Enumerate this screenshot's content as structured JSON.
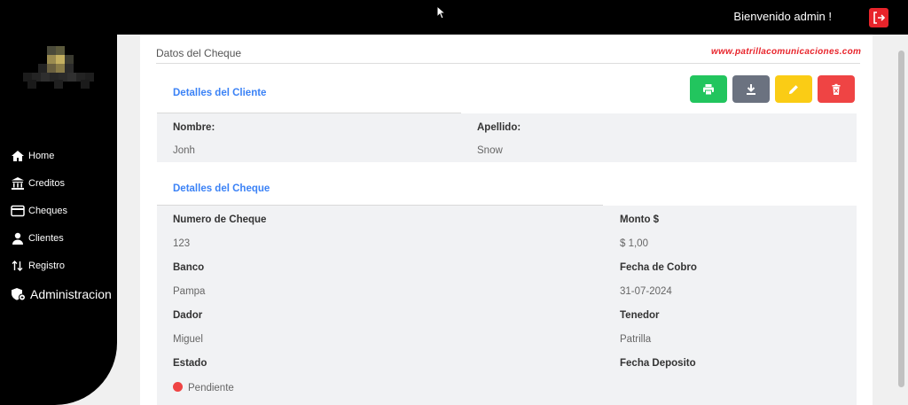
{
  "header": {
    "welcome": "Bienvenido admin !"
  },
  "sidebar": {
    "items": [
      {
        "label": "Home",
        "icon": "home-icon"
      },
      {
        "label": "Creditos",
        "icon": "bank-icon"
      },
      {
        "label": "Cheques",
        "icon": "card-icon"
      },
      {
        "label": "Clientes",
        "icon": "user-icon"
      },
      {
        "label": "Registro",
        "icon": "arrows-icon"
      },
      {
        "label": "Administracion",
        "icon": "shield-icon"
      }
    ]
  },
  "page": {
    "title": "Datos del Cheque",
    "watermark": "www.patrillacomunicaciones.com"
  },
  "actions": {
    "colors": {
      "print": "#22c55e",
      "download": "#6b7280",
      "edit": "#facc15",
      "delete": "#ef4444"
    }
  },
  "cliente": {
    "section_title": "Detalles del Cliente",
    "nombre_label": "Nombre:",
    "nombre": "Jonh",
    "apellido_label": "Apellido:",
    "apellido": "Snow"
  },
  "cheque": {
    "section_title": "Detalles del Cheque",
    "numero_label": "Numero de Cheque",
    "numero": "123",
    "monto_label": "Monto $",
    "monto": "$ 1,00",
    "banco_label": "Banco",
    "banco": "Pampa",
    "fecha_cobro_label": "Fecha de Cobro",
    "fecha_cobro": "31-07-2024",
    "dador_label": "Dador",
    "dador": "Miguel",
    "tenedor_label": "Tenedor",
    "tenedor": "Patrilla",
    "estado_label": "Estado",
    "estado": "Pendiente",
    "estado_color": "#ef4444",
    "fecha_deposito_label": "Fecha Deposito"
  }
}
